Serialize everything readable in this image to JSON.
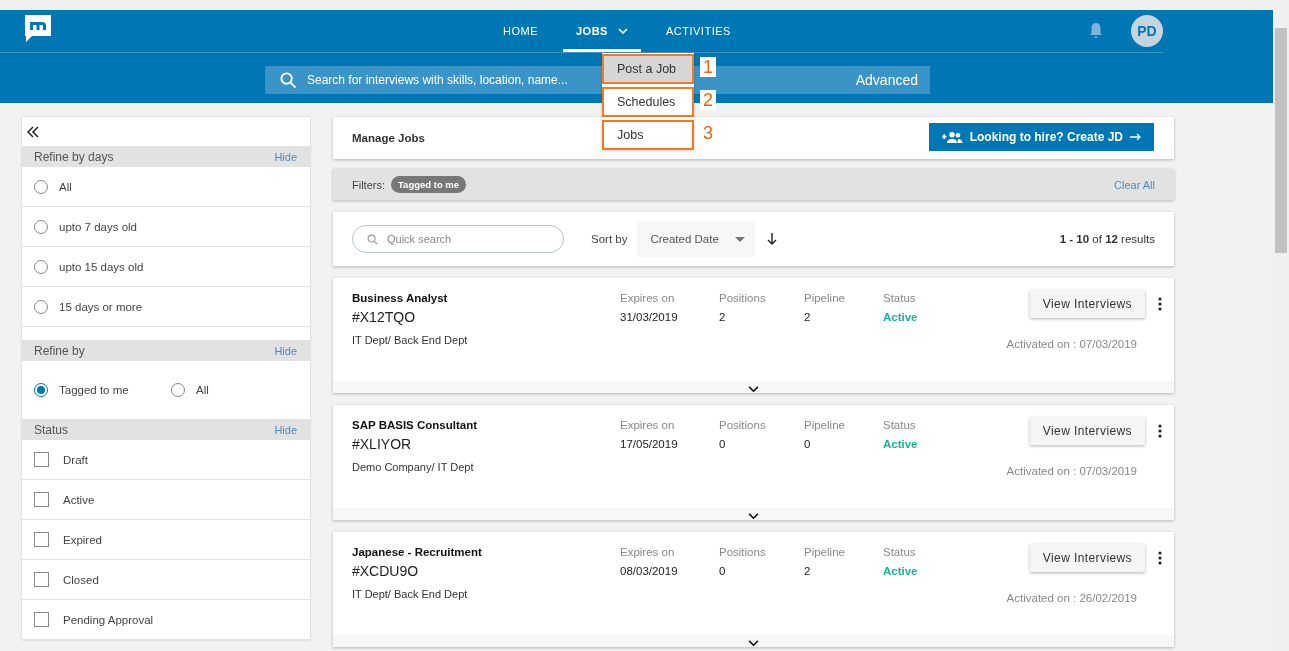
{
  "header": {
    "nav": [
      {
        "label": "HOME",
        "selected": false,
        "caret": false
      },
      {
        "label": "JOBS",
        "selected": true,
        "caret": true
      },
      {
        "label": "ACTIVITIES",
        "selected": false,
        "caret": false
      }
    ],
    "avatar": "PD",
    "search": {
      "placeholder": "Search for interviews with skills, location, name...",
      "advanced": "Advanced"
    }
  },
  "dropdown": {
    "items": [
      {
        "label": "Post a Job",
        "selected": true,
        "callout": "1"
      },
      {
        "label": "Schedules",
        "selected": false,
        "callout": "2"
      },
      {
        "label": "Jobs",
        "selected": false,
        "callout": "3"
      }
    ]
  },
  "sidebar": {
    "sections": [
      {
        "title": "Refine by days",
        "hide": "Hide",
        "kind": "radio-list",
        "options": [
          {
            "label": "All",
            "selected": false
          },
          {
            "label": "upto 7 days old",
            "selected": false
          },
          {
            "label": "upto 15 days old",
            "selected": false
          },
          {
            "label": "15 days or more",
            "selected": false
          }
        ]
      },
      {
        "title": "Refine by",
        "hide": "Hide",
        "kind": "radio-inline",
        "options": [
          {
            "label": "Tagged to me",
            "selected": true
          },
          {
            "label": "All",
            "selected": false
          }
        ]
      },
      {
        "title": "Status",
        "hide": "Hide",
        "kind": "checkbox-list",
        "options": [
          {
            "label": "Draft",
            "checked": false
          },
          {
            "label": "Active",
            "checked": false
          },
          {
            "label": "Expired",
            "checked": false
          },
          {
            "label": "Closed",
            "checked": false
          },
          {
            "label": "Pending Approval",
            "checked": false
          }
        ]
      }
    ]
  },
  "main": {
    "title": "Manage Jobs",
    "create_button": "Looking to hire? Create JD",
    "filters": {
      "label": "Filters:",
      "tags": [
        "Tagged to me"
      ],
      "clear": "Clear All"
    },
    "toolbar": {
      "search_placeholder": "Quick search",
      "sort_label": "Sort by",
      "sort_value": "Created Date",
      "results": "**1 - 10** of **12** results"
    },
    "jobs": [
      {
        "title": "Business Analyst",
        "code": "#X12TQO",
        "departments": "IT Dept/ Back End Dept",
        "expires_label": "Expires on",
        "expires": "31/03/2019",
        "positions_label": "Positions",
        "positions": "2",
        "pipeline_label": "Pipeline",
        "pipeline": "2",
        "status_label": "Status",
        "status": "Active",
        "button": "View Interviews",
        "activated": "Activated on : 07/03/2019"
      },
      {
        "title": "SAP BASIS Consultant",
        "code": "#XLIYOR",
        "departments": "Demo Company/ IT Dept",
        "expires_label": "Expires on",
        "expires": "17/05/2019",
        "positions_label": "Positions",
        "positions": "0",
        "pipeline_label": "Pipeline",
        "pipeline": "0",
        "status_label": "Status",
        "status": "Active",
        "button": "View Interviews",
        "activated": "Activated on : 07/03/2019"
      },
      {
        "title": "Japanese - Recruitment",
        "code": "#XCDU9O",
        "departments": "IT Dept/ Back End Dept",
        "expires_label": "Expires on",
        "expires": "08/03/2019",
        "positions_label": "Positions",
        "positions": "0",
        "pipeline_label": "Pipeline",
        "pipeline": "2",
        "status_label": "Status",
        "status": "Active",
        "button": "View Interviews",
        "activated": "Activated on : 26/02/2019"
      }
    ]
  }
}
